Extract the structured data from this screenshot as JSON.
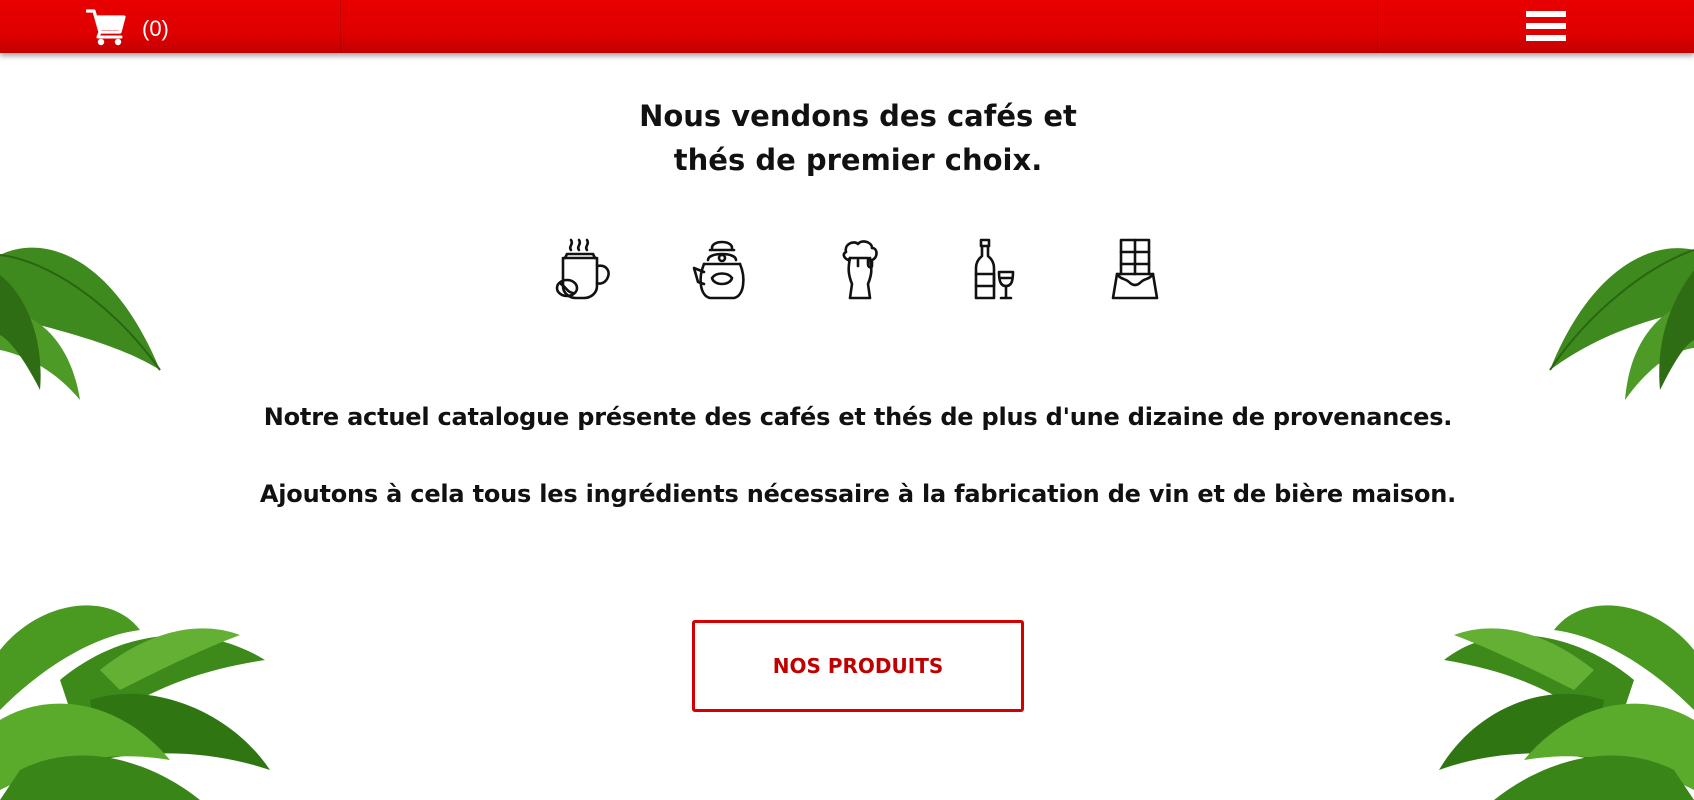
{
  "topbar": {
    "cart_count": "(0)",
    "cart_icon": "cart-icon",
    "menu_icon": "hamburger-menu-icon",
    "color": "#e00000"
  },
  "hero": {
    "headline_line1": "Nous vendons des cafés et",
    "headline_line2": "thés de premier choix."
  },
  "product_icons": [
    "coffee-cup-icon",
    "teapot-icon",
    "beer-glass-icon",
    "wine-bottle-glass-icon",
    "chocolate-bar-icon"
  ],
  "text": {
    "paragraph1": "Notre actuel catalogue présente des cafés et thés de plus d'une dizaine de provenances.",
    "paragraph2": "Ajoutons à cela tous les ingrédients nécessaire à la fabrication de vin et de bière maison."
  },
  "cta": {
    "label": "NOS PRODUITS",
    "color": "#d40000"
  }
}
